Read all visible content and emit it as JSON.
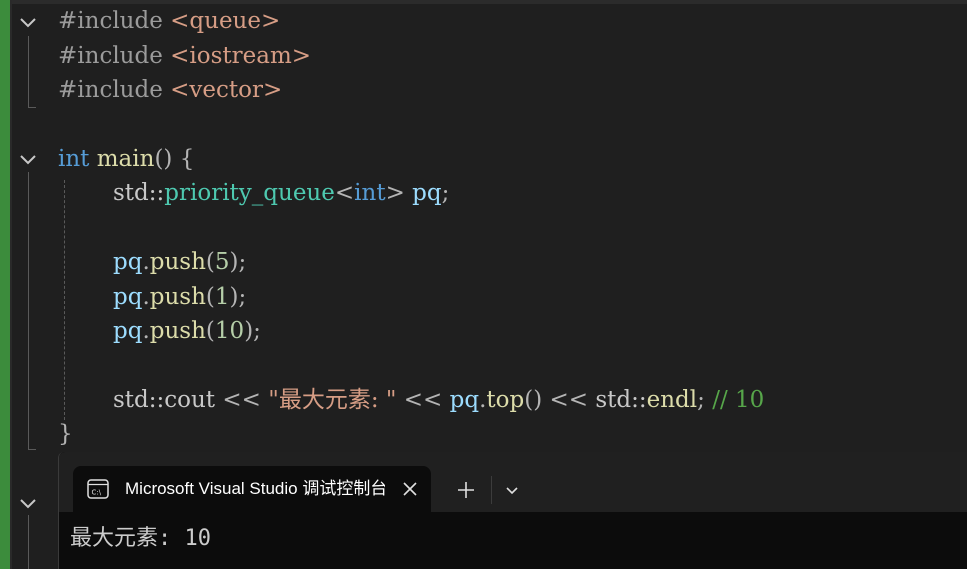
{
  "code": {
    "line1": {
      "directive": "#include",
      "header": "<queue>"
    },
    "line2": {
      "directive": "#include",
      "header": "<iostream>"
    },
    "line3": {
      "directive": "#include",
      "header": "<vector>"
    },
    "line5": {
      "kw": "int",
      "fn": "main",
      "rest": "() {"
    },
    "line6": {
      "ns": "std::",
      "type": "priority_queue",
      "lt": "<",
      "kw": "int",
      "gt": ">",
      "var": "pq",
      "end": ";"
    },
    "line8": {
      "var": "pq",
      "dot": ".",
      "fn": "push",
      "open": "(",
      "num": "5",
      "close": ");"
    },
    "line9": {
      "var": "pq",
      "dot": ".",
      "fn": "push",
      "open": "(",
      "num": "1",
      "close": ");"
    },
    "line10": {
      "var": "pq",
      "dot": ".",
      "fn": "push",
      "open": "(",
      "num": "10",
      "close": ");"
    },
    "line12": {
      "ns": "std::cout",
      "op1": " << ",
      "str": "\"最大元素: \"",
      "op2": " << ",
      "var": "pq",
      "dot": ".",
      "fn": "top",
      "paren": "()",
      "op3": " << ",
      "ns2": "std::",
      "endl": "endl",
      "semi": ";",
      "comment": " // 10"
    },
    "line13": {
      "brace": "}"
    }
  },
  "terminal": {
    "tab_title": "Microsoft Visual Studio 调试控制台",
    "new_tab_symbol": "+",
    "output": "最大元素: 10"
  },
  "colors": {
    "background": "#1f1f1f",
    "change_bar": "#3c8c3c",
    "keyword": "#569cd6",
    "function": "#dcdcaa",
    "type": "#4ec9b0",
    "variable": "#9cdcfe",
    "string": "#d69d85",
    "comment": "#57a64a",
    "terminal_bg": "#0c0c0c"
  },
  "icons": [
    "fold-chevron-icon",
    "terminal-app-icon",
    "close-icon",
    "plus-icon",
    "chevron-down-icon"
  ]
}
